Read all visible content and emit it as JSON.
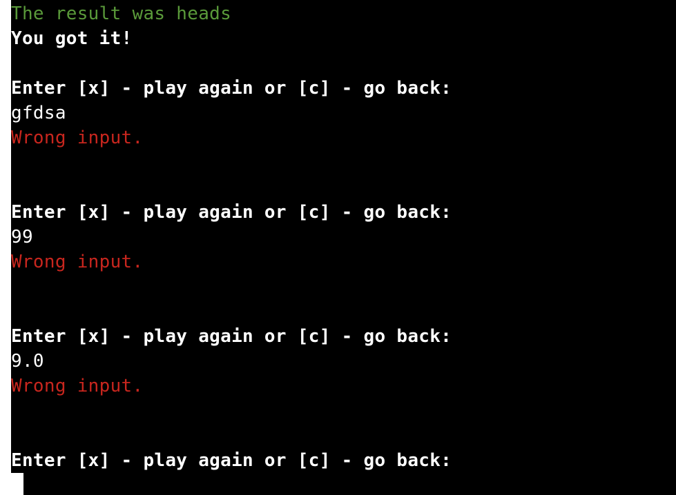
{
  "terminal": {
    "lines": [
      {
        "text": "The result was heads",
        "color": "green",
        "bold": false
      },
      {
        "text": "You got it!",
        "color": "white",
        "bold": true
      },
      {
        "text": "",
        "color": "white",
        "bold": false
      },
      {
        "text": "Enter [x] - play again or [c] - go back:",
        "color": "white",
        "bold": true
      },
      {
        "text": "gfdsa",
        "color": "white",
        "bold": false
      },
      {
        "text": "Wrong input.",
        "color": "red",
        "bold": false
      },
      {
        "text": "",
        "color": "white",
        "bold": false
      },
      {
        "text": "",
        "color": "white",
        "bold": false
      },
      {
        "text": "Enter [x] - play again or [c] - go back:",
        "color": "white",
        "bold": true
      },
      {
        "text": "99",
        "color": "white",
        "bold": false
      },
      {
        "text": "Wrong input.",
        "color": "red",
        "bold": false
      },
      {
        "text": "",
        "color": "white",
        "bold": false
      },
      {
        "text": "",
        "color": "white",
        "bold": false
      },
      {
        "text": "Enter [x] - play again or [c] - go back:",
        "color": "white",
        "bold": true
      },
      {
        "text": "9.0",
        "color": "white",
        "bold": false
      },
      {
        "text": "Wrong input.",
        "color": "red",
        "bold": false
      },
      {
        "text": "",
        "color": "white",
        "bold": false
      },
      {
        "text": "",
        "color": "white",
        "bold": false
      },
      {
        "text": "Enter [x] - play again or [c] - go back:",
        "color": "white",
        "bold": true
      }
    ],
    "colors": {
      "green": "#5a9a3a",
      "red": "#c8261e",
      "white": "#ffffff",
      "background": "#000000"
    }
  }
}
